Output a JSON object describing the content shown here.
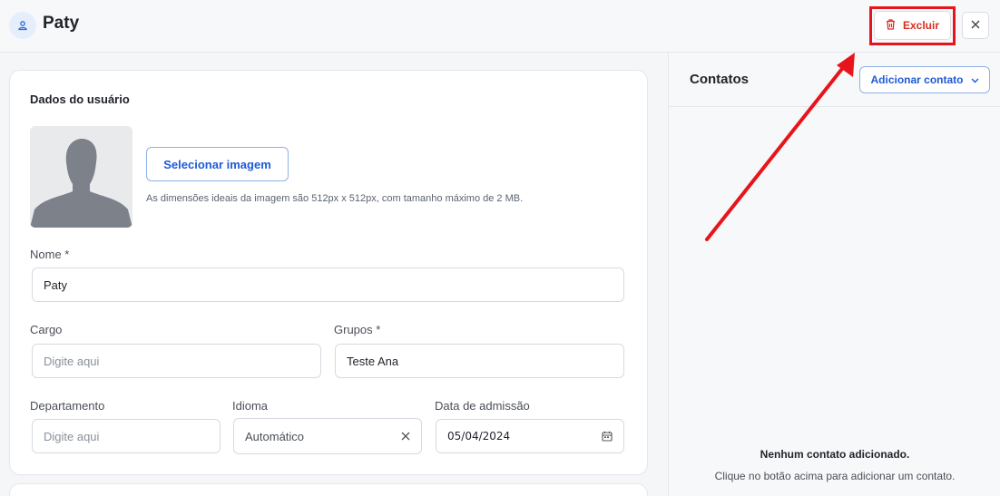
{
  "header": {
    "title": "Paty",
    "delete_label": "Excluir",
    "icons": {
      "avatar": "user-icon",
      "delete": "trash-icon",
      "close": "close-icon"
    }
  },
  "user_form": {
    "section_title": "Dados do usuário",
    "select_image_label": "Selecionar imagem",
    "image_hint": "As dimensões ideais da imagem são 512px x 512px, com tamanho máximo de 2 MB.",
    "fields": {
      "nome": {
        "label": "Nome *",
        "value": "Paty"
      },
      "cargo": {
        "label": "Cargo",
        "placeholder": "Digite aqui"
      },
      "grupos": {
        "label": "Grupos *",
        "value": "Teste Ana"
      },
      "departamento": {
        "label": "Departamento",
        "placeholder": "Digite aqui"
      },
      "idioma": {
        "label": "Idioma",
        "value": "Automático"
      },
      "data_admissao": {
        "label": "Data de admissão",
        "value": "05/04/2024"
      }
    }
  },
  "contacts": {
    "title": "Contatos",
    "add_label": "Adicionar contato",
    "empty_title": "Nenhum contato adicionado.",
    "empty_subtitle": "Clique no botão acima para adicionar um contato."
  },
  "colors": {
    "accent": "#1d5bd6",
    "danger": "#d92d20",
    "annotation": "#e8141b"
  }
}
